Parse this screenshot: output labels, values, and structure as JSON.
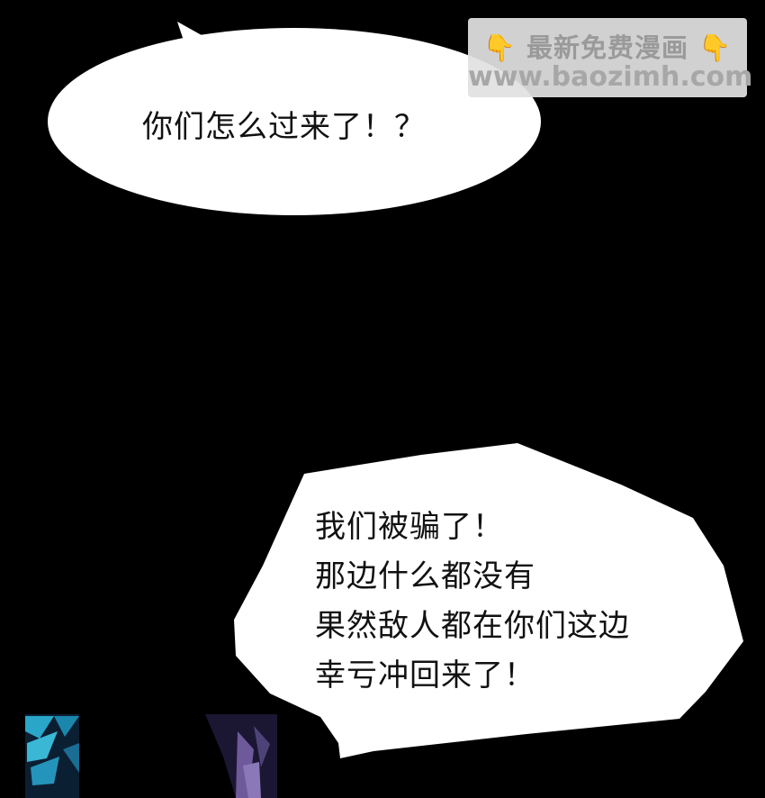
{
  "bubble_top": {
    "text": "你们怎么过来了！？"
  },
  "bubble_bottom": {
    "lines": [
      "我们被骗了！",
      "那边什么都没有",
      "果然敌人都在你们这边",
      "幸亏冲回来了！"
    ]
  },
  "watermark": {
    "line1": "最新免费漫画",
    "line2": "www.baozimh.com",
    "hand_icon": "👇"
  },
  "colors": {
    "background": "#000000",
    "bubble": "#ffffff",
    "text": "#111111",
    "watermark_bg": "#e1e1e1",
    "accent_blue": "#2aa6c9",
    "accent_purple": "#6e5a9b"
  }
}
